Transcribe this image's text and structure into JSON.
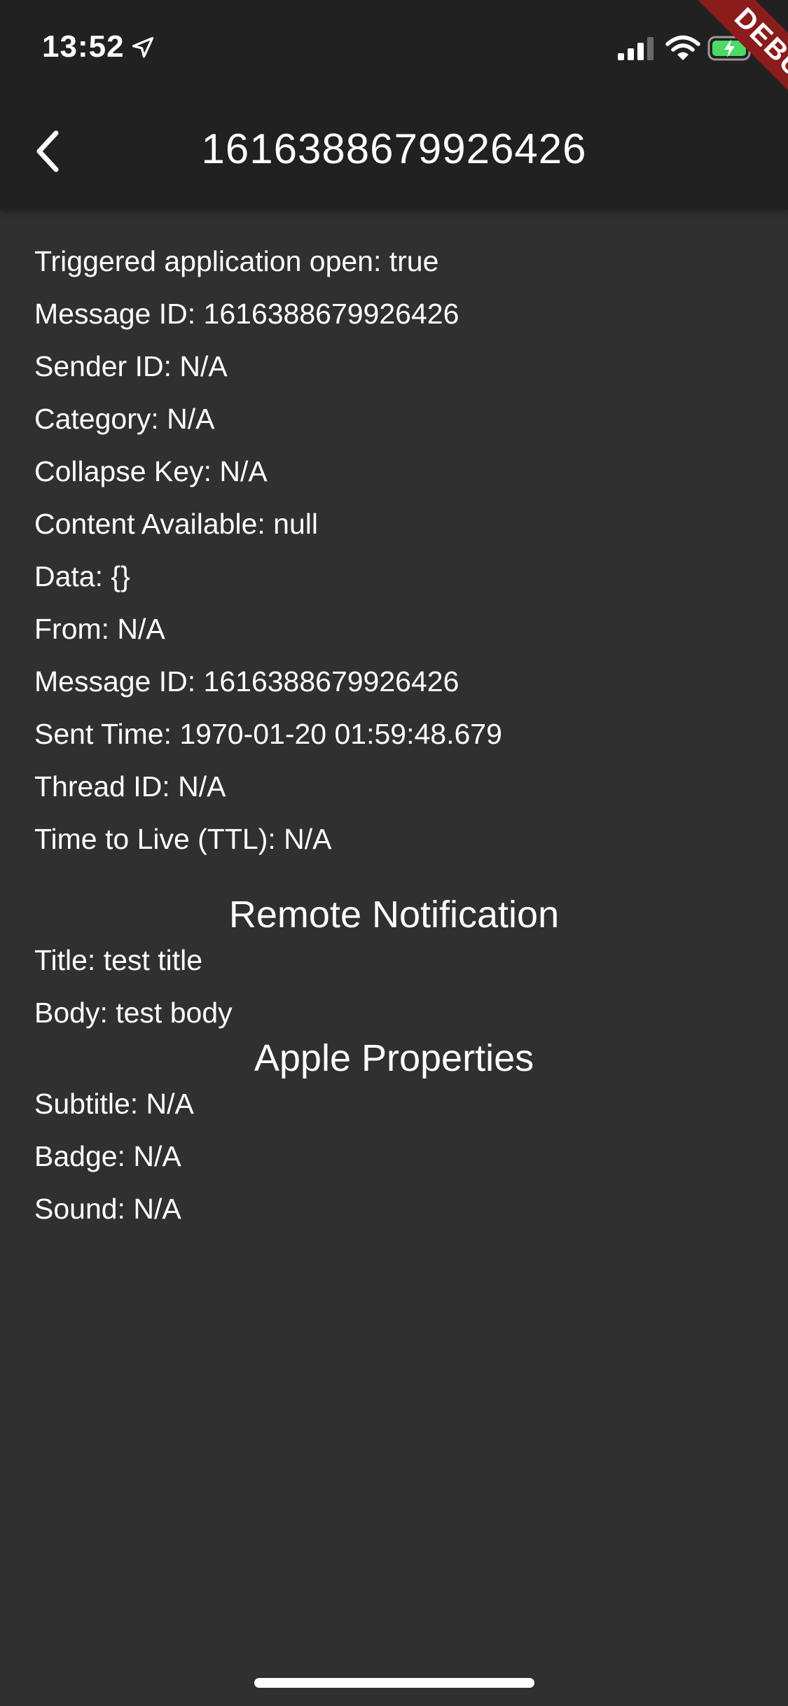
{
  "status_bar": {
    "time": "13:52",
    "icons": [
      "location-arrow-icon",
      "cellular-signal-icon",
      "wifi-icon",
      "battery-charging-icon"
    ],
    "debug_banner": "DEBUG"
  },
  "app_bar": {
    "back_icon": "chevron-left-icon",
    "title": "1616388679926426"
  },
  "message_fields": [
    "Triggered application open: true",
    "Message ID: 1616388679926426",
    "Sender ID: N/A",
    "Category: N/A",
    "Collapse Key: N/A",
    "Content Available: null",
    "Data: {}",
    "From: N/A",
    "Message ID: 1616388679926426",
    "Sent Time: 1970-01-20 01:59:48.679",
    "Thread ID: N/A",
    "Time to Live (TTL): N/A"
  ],
  "remote_notification": {
    "heading": "Remote Notification",
    "fields": [
      "Title: test title",
      "Body: test body"
    ]
  },
  "apple_properties": {
    "heading": "Apple Properties",
    "fields": [
      "Subtitle: N/A",
      "Badge: N/A",
      "Sound: N/A"
    ]
  },
  "colors": {
    "background": "#303030",
    "app_bar": "#212121",
    "debug_banner": "#8b1c1c",
    "text": "#ffffff",
    "battery_fill": "#4cd964"
  }
}
